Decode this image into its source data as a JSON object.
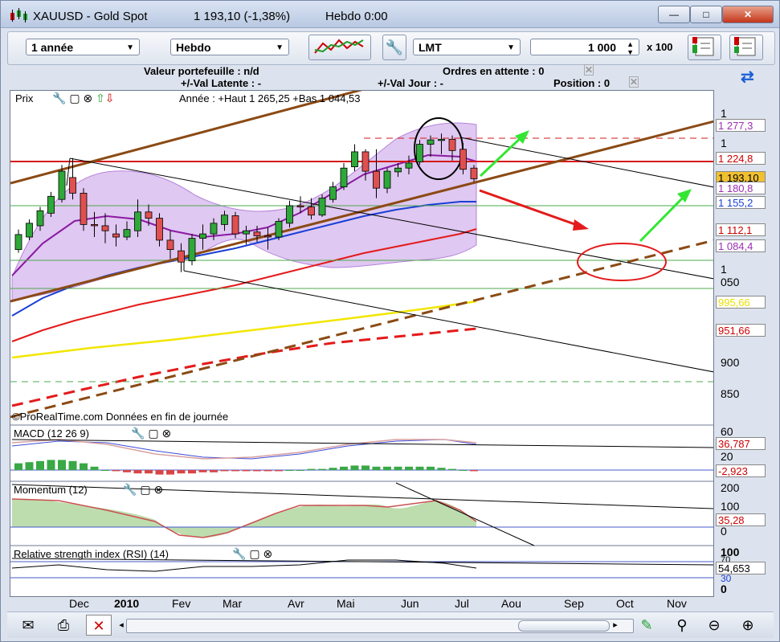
{
  "window": {
    "symbol": "XAUUSD - Gold Spot",
    "quote": "1 193,10 (-1,38%)",
    "period_info": "Hebdo  0:00",
    "minimize": "—",
    "maximize": "□",
    "close": "✕"
  },
  "toolbar": {
    "range": "1 année",
    "timeframe": "Hebdo",
    "order_type": "LMT",
    "quantity": "1 000",
    "multiplier": "x 100"
  },
  "info": {
    "portfolio": "Valeur portefeuille : n/d",
    "pending_orders": "Ordres en attente : 0",
    "latent": "+/-Val Latente : -",
    "day": "+/-Val Jour : -",
    "position": "Position : 0"
  },
  "price_panel": {
    "label": "Prix",
    "annotation": "Année : +Haut 1 265,25 +Bas 1 044,53",
    "copyright": "©ProRealTime.com  Données en fin de journée",
    "y_ticks": [
      "1 300",
      "1 250",
      "1 050",
      "900",
      "850"
    ],
    "tags": [
      {
        "text": "1 277,3",
        "color": "#9b2fb3"
      },
      {
        "text": "1 224,8",
        "color": "#cc0000"
      },
      {
        "text": "1 193,10",
        "color": "#000000"
      },
      {
        "text": "1 180,8",
        "color": "#9b2fb3"
      },
      {
        "text": "1 155,2",
        "color": "#1a3fd6"
      },
      {
        "text": "1 112,1",
        "color": "#cc0000"
      },
      {
        "text": "1 084,4",
        "color": "#9b2fb3"
      },
      {
        "text": "995,66",
        "color": "#e8e000"
      },
      {
        "text": "951,66",
        "color": "#cc0000"
      }
    ]
  },
  "macd_panel": {
    "label": "MACD (12 26 9)",
    "y_ticks": [
      "60",
      "20"
    ],
    "tags": [
      {
        "text": "36,787",
        "color": "#cc0000"
      },
      {
        "text": "-2,923",
        "color": "#cc0000"
      }
    ]
  },
  "momentum_panel": {
    "label": "Momentum (12)",
    "y_ticks": [
      "200",
      "100",
      "0"
    ],
    "tags": [
      {
        "text": "35,28",
        "color": "#cc0000"
      }
    ]
  },
  "rsi_panel": {
    "label": "Relative strength index (RSI) (14)",
    "y_ticks": [
      "100",
      "70",
      "30",
      "0"
    ],
    "tags": [
      {
        "text": "54,653",
        "color": "#000000"
      }
    ]
  },
  "x_axis": [
    "Dec",
    "2010",
    "Fev",
    "Mar",
    "Avr",
    "Mai",
    "Jun",
    "Jul",
    "Aou",
    "Sep",
    "Oct",
    "Nov"
  ],
  "chart_data": {
    "type": "candlestick",
    "title": "XAUUSD - Gold Spot",
    "timeframe": "weekly",
    "ylim": [
      820,
      1320
    ],
    "y_ticks": [
      850,
      900,
      1050,
      1250,
      1300
    ],
    "year_high": 1265.25,
    "year_low": 1044.53,
    "last": 1193.1,
    "change_pct": -1.38,
    "candles": [
      {
        "o": 1080,
        "h": 1112,
        "l": 1075,
        "c": 1104
      },
      {
        "o": 1100,
        "h": 1128,
        "l": 1095,
        "c": 1122
      },
      {
        "o": 1118,
        "h": 1148,
        "l": 1110,
        "c": 1142
      },
      {
        "o": 1138,
        "h": 1172,
        "l": 1132,
        "c": 1165
      },
      {
        "o": 1160,
        "h": 1215,
        "l": 1155,
        "c": 1205
      },
      {
        "o": 1195,
        "h": 1226,
        "l": 1160,
        "c": 1170
      },
      {
        "o": 1170,
        "h": 1178,
        "l": 1110,
        "c": 1120
      },
      {
        "o": 1120,
        "h": 1140,
        "l": 1100,
        "c": 1118
      },
      {
        "o": 1118,
        "h": 1138,
        "l": 1090,
        "c": 1110
      },
      {
        "o": 1105,
        "h": 1120,
        "l": 1085,
        "c": 1100
      },
      {
        "o": 1100,
        "h": 1125,
        "l": 1095,
        "c": 1112
      },
      {
        "o": 1110,
        "h": 1160,
        "l": 1100,
        "c": 1140
      },
      {
        "o": 1140,
        "h": 1152,
        "l": 1118,
        "c": 1130
      },
      {
        "o": 1130,
        "h": 1138,
        "l": 1085,
        "c": 1095
      },
      {
        "o": 1095,
        "h": 1110,
        "l": 1065,
        "c": 1080
      },
      {
        "o": 1078,
        "h": 1090,
        "l": 1044,
        "c": 1060
      },
      {
        "o": 1062,
        "h": 1105,
        "l": 1055,
        "c": 1098
      },
      {
        "o": 1098,
        "h": 1120,
        "l": 1080,
        "c": 1105
      },
      {
        "o": 1105,
        "h": 1130,
        "l": 1095,
        "c": 1122
      },
      {
        "o": 1120,
        "h": 1142,
        "l": 1110,
        "c": 1135
      },
      {
        "o": 1134,
        "h": 1140,
        "l": 1098,
        "c": 1105
      },
      {
        "o": 1105,
        "h": 1118,
        "l": 1088,
        "c": 1110
      },
      {
        "o": 1108,
        "h": 1118,
        "l": 1092,
        "c": 1102
      },
      {
        "o": 1102,
        "h": 1115,
        "l": 1080,
        "c": 1100
      },
      {
        "o": 1100,
        "h": 1130,
        "l": 1095,
        "c": 1125
      },
      {
        "o": 1122,
        "h": 1158,
        "l": 1115,
        "c": 1150
      },
      {
        "o": 1150,
        "h": 1165,
        "l": 1138,
        "c": 1148
      },
      {
        "o": 1148,
        "h": 1162,
        "l": 1128,
        "c": 1135
      },
      {
        "o": 1135,
        "h": 1168,
        "l": 1132,
        "c": 1162
      },
      {
        "o": 1160,
        "h": 1188,
        "l": 1155,
        "c": 1180
      },
      {
        "o": 1180,
        "h": 1218,
        "l": 1175,
        "c": 1210
      },
      {
        "o": 1212,
        "h": 1248,
        "l": 1205,
        "c": 1236
      },
      {
        "o": 1236,
        "h": 1240,
        "l": 1190,
        "c": 1205
      },
      {
        "o": 1205,
        "h": 1240,
        "l": 1162,
        "c": 1178
      },
      {
        "o": 1178,
        "h": 1210,
        "l": 1170,
        "c": 1205
      },
      {
        "o": 1204,
        "h": 1218,
        "l": 1196,
        "c": 1210
      },
      {
        "o": 1210,
        "h": 1230,
        "l": 1200,
        "c": 1218
      },
      {
        "o": 1220,
        "h": 1255,
        "l": 1215,
        "c": 1248
      },
      {
        "o": 1248,
        "h": 1262,
        "l": 1228,
        "c": 1255
      },
      {
        "o": 1254,
        "h": 1265,
        "l": 1232,
        "c": 1256
      },
      {
        "o": 1256,
        "h": 1262,
        "l": 1222,
        "c": 1238
      },
      {
        "o": 1240,
        "h": 1250,
        "l": 1200,
        "c": 1208
      },
      {
        "o": 1210,
        "h": 1215,
        "l": 1188,
        "c": 1193
      }
    ]
  }
}
